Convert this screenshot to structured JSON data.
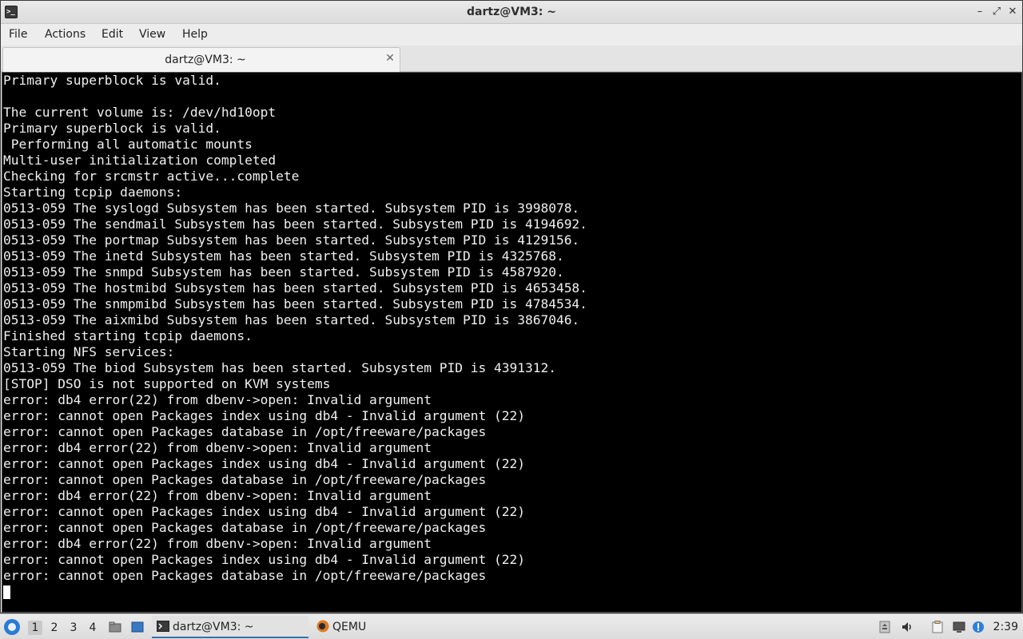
{
  "window": {
    "title": "dartz@VM3: ~",
    "controls": [
      "minimize-icon",
      "maximize-icon",
      "close-icon"
    ]
  },
  "menubar": {
    "items": [
      "File",
      "Actions",
      "Edit",
      "View",
      "Help"
    ]
  },
  "tabs": [
    {
      "label": "dartz@VM3: ~",
      "close_icon": "close-icon"
    }
  ],
  "terminal": {
    "background": "#000000",
    "foreground": "#f0f0f0",
    "lines": [
      "Primary superblock is valid.",
      "",
      "The current volume is: /dev/hd10opt",
      "Primary superblock is valid.",
      " Performing all automatic mounts",
      "Multi-user initialization completed",
      "Checking for srcmstr active...complete",
      "Starting tcpip daemons:",
      "0513-059 The syslogd Subsystem has been started. Subsystem PID is 3998078.",
      "0513-059 The sendmail Subsystem has been started. Subsystem PID is 4194692.",
      "0513-059 The portmap Subsystem has been started. Subsystem PID is 4129156.",
      "0513-059 The inetd Subsystem has been started. Subsystem PID is 4325768.",
      "0513-059 The snmpd Subsystem has been started. Subsystem PID is 4587920.",
      "0513-059 The hostmibd Subsystem has been started. Subsystem PID is 4653458.",
      "0513-059 The snmpmibd Subsystem has been started. Subsystem PID is 4784534.",
      "0513-059 The aixmibd Subsystem has been started. Subsystem PID is 3867046.",
      "Finished starting tcpip daemons.",
      "Starting NFS services:",
      "0513-059 The biod Subsystem has been started. Subsystem PID is 4391312.",
      "[STOP] DSO is not supported on KVM systems",
      "error: db4 error(22) from dbenv->open: Invalid argument",
      "error: cannot open Packages index using db4 - Invalid argument (22)",
      "error: cannot open Packages database in /opt/freeware/packages",
      "error: db4 error(22) from dbenv->open: Invalid argument",
      "error: cannot open Packages index using db4 - Invalid argument (22)",
      "error: cannot open Packages database in /opt/freeware/packages",
      "error: db4 error(22) from dbenv->open: Invalid argument",
      "error: cannot open Packages index using db4 - Invalid argument (22)",
      "error: cannot open Packages database in /opt/freeware/packages",
      "error: db4 error(22) from dbenv->open: Invalid argument",
      "error: cannot open Packages index using db4 - Invalid argument (22)",
      "error: cannot open Packages database in /opt/freeware/packages"
    ]
  },
  "taskbar": {
    "start_icon": "lxqt-menu-icon",
    "workspaces": [
      "1",
      "2",
      "3",
      "4"
    ],
    "active_workspace": "1",
    "launchers": [
      "file-manager-icon",
      "show-desktop-icon"
    ],
    "tasks": [
      {
        "label": "dartz@VM3: ~",
        "icon": "terminal-icon",
        "active": true
      },
      {
        "label": "QEMU",
        "icon": "qemu-icon",
        "active": false
      }
    ],
    "tray": [
      "removable-media-icon",
      "volume-icon",
      "clipboard-icon",
      "display-icon",
      "notification-icon"
    ],
    "clock": "2:39"
  }
}
